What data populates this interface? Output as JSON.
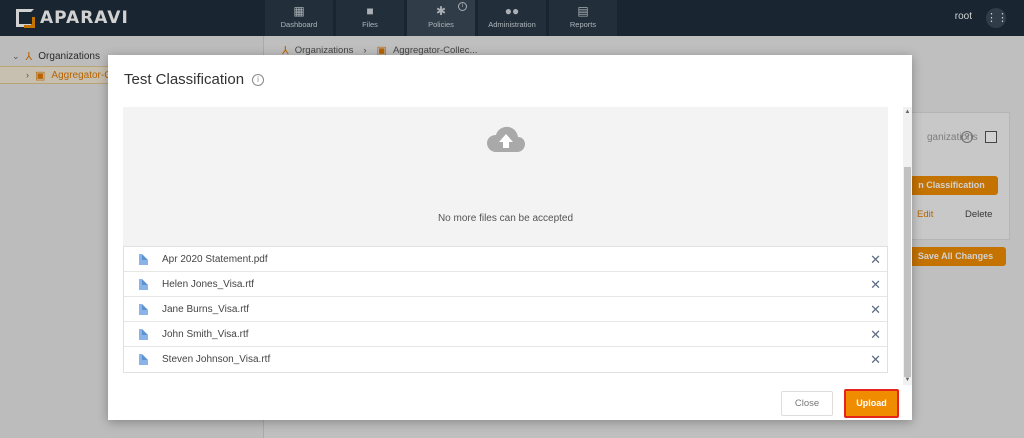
{
  "topbar": {
    "logo_text": "APARAVI",
    "nav": [
      {
        "label": "Dashboard",
        "icon": "dashboard-icon"
      },
      {
        "label": "Files",
        "icon": "folder-icon"
      },
      {
        "label": "Policies",
        "icon": "gear-icon",
        "active": true,
        "info": "i"
      },
      {
        "label": "Administration",
        "icon": "users-icon"
      },
      {
        "label": "Reports",
        "icon": "clipboard-icon"
      }
    ],
    "user": "root",
    "apps_icon": "grid-icon"
  },
  "sidebar": {
    "items": [
      {
        "label": "Organizations",
        "icon": "organization-icon",
        "chevron": "⌄"
      },
      {
        "label": "Aggregator-Collec",
        "icon": "aggregator-icon",
        "chevron": "›"
      }
    ]
  },
  "breadcrumb": {
    "items": [
      "Organizations",
      "Aggregator-Collec..."
    ],
    "separator": "›"
  },
  "background_panel": {
    "orgs_text": "ganizations",
    "primary_button": "n Classification",
    "edit_link": "Edit",
    "delete_link": "Delete",
    "save_button": "Save All Changes"
  },
  "modal": {
    "title": "Test Classification",
    "dropzone": {
      "icon": "cloud-upload-icon",
      "message": "No more files can be accepted"
    },
    "files": [
      {
        "name": "Apr 2020 Statement.pdf"
      },
      {
        "name": "Helen Jones_Visa.rtf"
      },
      {
        "name": "Jane Burns_Visa.rtf"
      },
      {
        "name": "John Smith_Visa.rtf"
      },
      {
        "name": "Steven Johnson_Visa.rtf"
      }
    ],
    "close_label": "Close",
    "upload_label": "Upload"
  },
  "colors": {
    "accent": "#f08c00",
    "topbar": "#1f2f3d",
    "highlight_border": "#e5241b"
  }
}
